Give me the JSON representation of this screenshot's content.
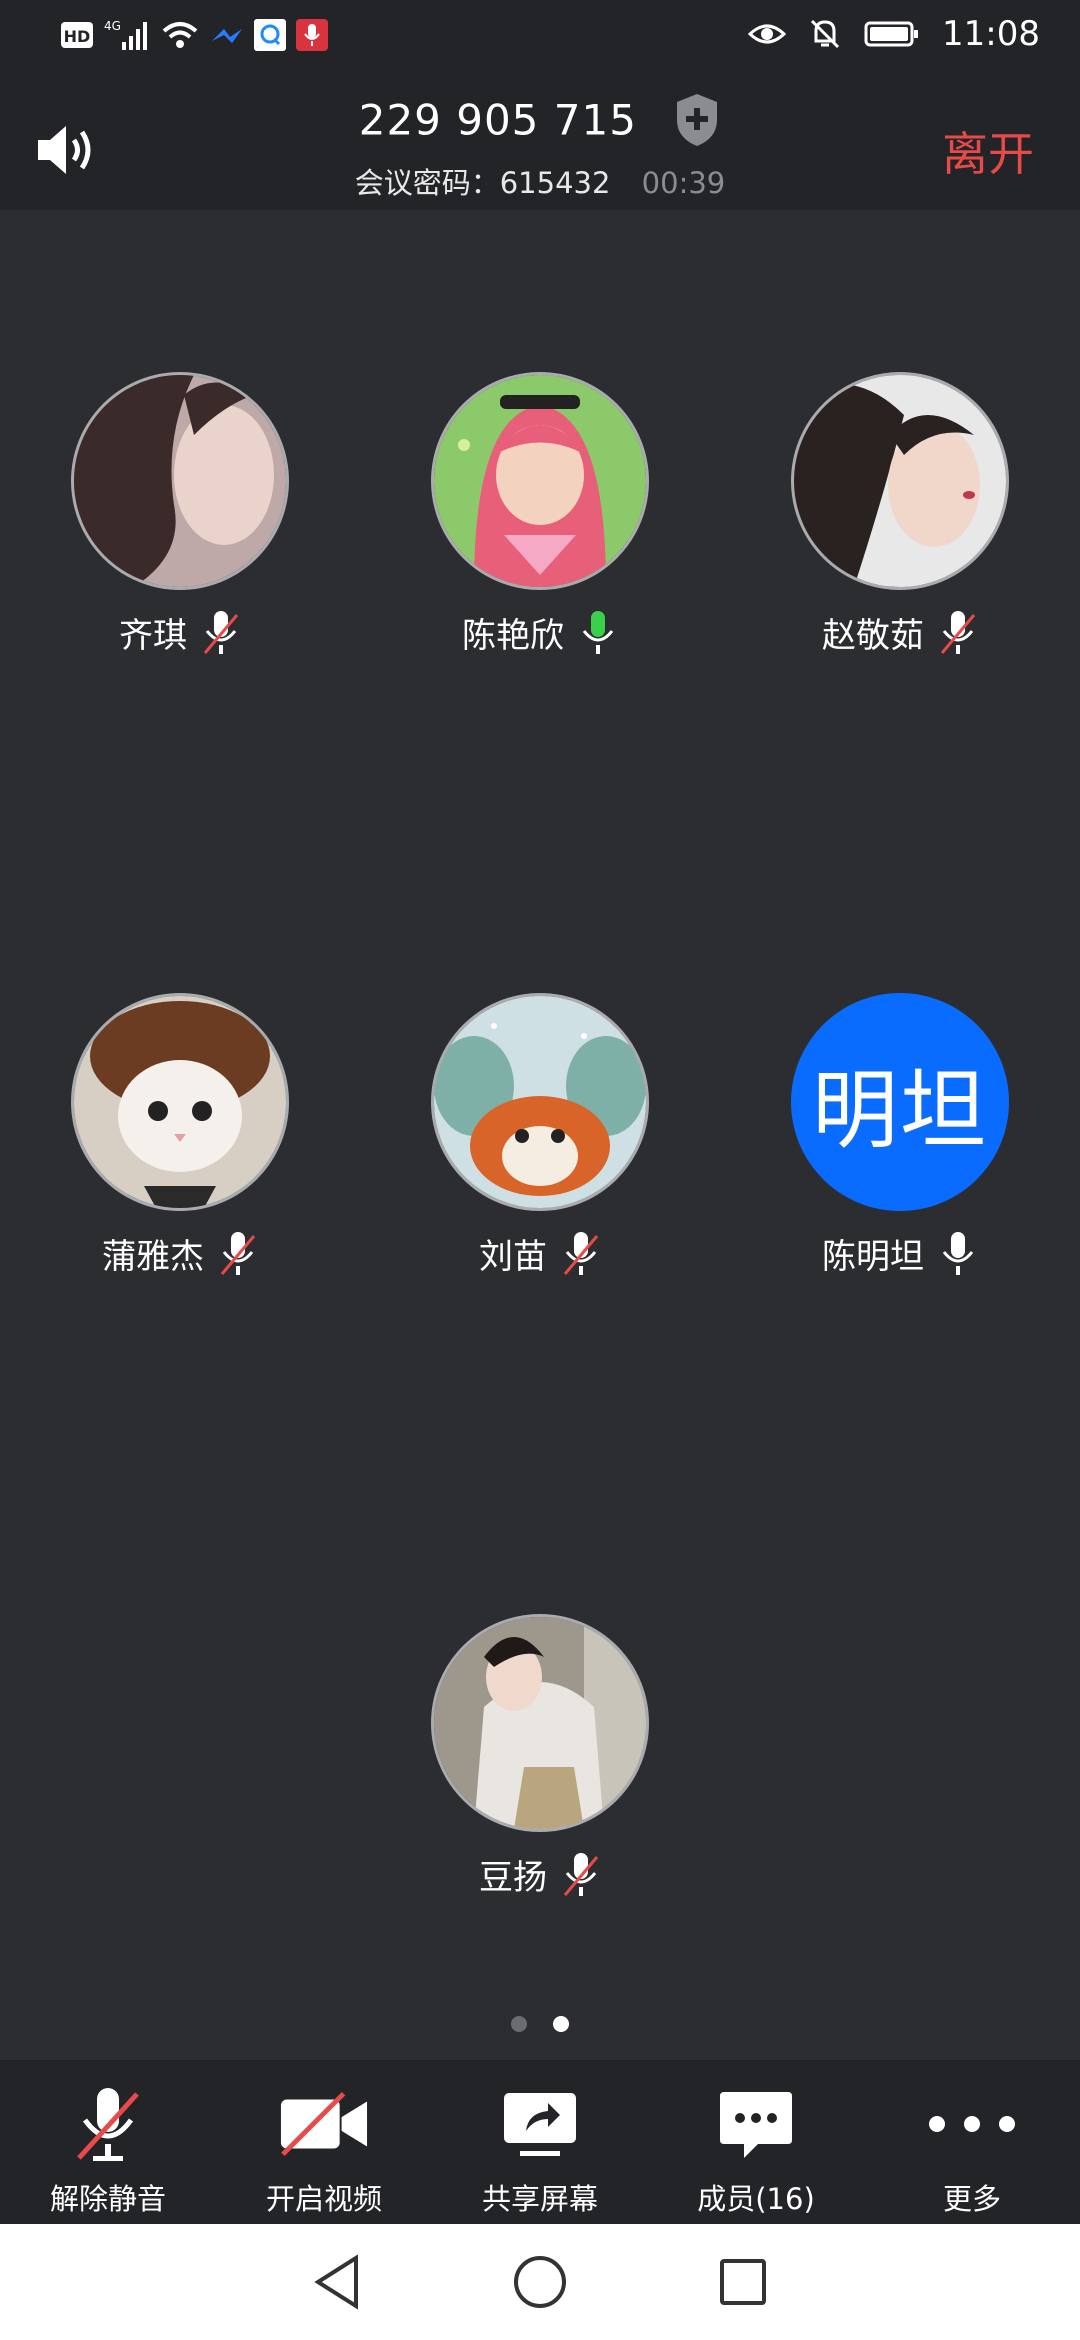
{
  "status_bar": {
    "time": "11:08",
    "hd_label": "HD",
    "network_label": "4G",
    "icons": [
      "hd-icon",
      "signal-icon",
      "wifi-icon",
      "feishu-icon",
      "qq-icon",
      "mic-app-icon",
      "eye-icon",
      "bell-off-icon",
      "battery-icon"
    ]
  },
  "header": {
    "meeting_id": "229 905 715",
    "password_label": "会议密码：615432",
    "timer": "00:39",
    "leave_label": "离开"
  },
  "participants": [
    {
      "name": "齐琪",
      "mic": "muted"
    },
    {
      "name": "陈艳欣",
      "mic": "speaking"
    },
    {
      "name": "赵敬茹",
      "mic": "muted"
    },
    {
      "name": "蒲雅杰",
      "mic": "muted"
    },
    {
      "name": "刘苗",
      "mic": "muted"
    },
    {
      "name": "陈明坦",
      "mic": "on",
      "avatar_text": "明坦"
    },
    {
      "name": "豆扬",
      "mic": "muted"
    }
  ],
  "pagination": {
    "pages": 2,
    "current": 2
  },
  "toolbar": {
    "unmute_label": "解除静音",
    "video_label": "开启视频",
    "share_label": "共享屏幕",
    "members_label": "成员(16)",
    "more_label": "更多"
  },
  "colors": {
    "background": "#2b2d31",
    "bar": "#232427",
    "leave": "#e84a4a",
    "speaking_mic": "#3bd04a",
    "muted_slash": "#e84a4a",
    "avatar_blue": "#0a6cff"
  }
}
